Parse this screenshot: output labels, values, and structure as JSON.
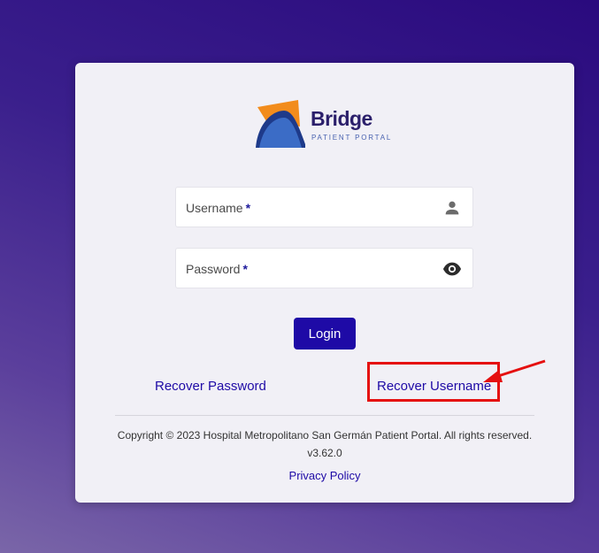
{
  "logo": {
    "title": "Bridge",
    "subtitle": "PATIENT PORTAL",
    "colors": {
      "orange": "#f28c1c",
      "navy": "#1e3a8a",
      "blue": "#3b6cc6"
    }
  },
  "form": {
    "username": {
      "label": "Username",
      "required_mark": "*",
      "value": "",
      "icon": "person-icon"
    },
    "password": {
      "label": "Password",
      "required_mark": "*",
      "value": "",
      "icon": "eye-icon"
    },
    "login_label": "Login"
  },
  "links": {
    "recover_password": "Recover Password",
    "recover_username": "Recover Username"
  },
  "footer": {
    "copyright": "Copyright © 2023 Hospital Metropolitano San Germán Patient Portal. All rights reserved.",
    "version": "v3.62.0",
    "privacy": "Privacy Policy"
  },
  "annotation": {
    "highlight_color": "#e51010"
  },
  "theme": {
    "accent": "#1e0aa6",
    "card_bg": "#f1f0f6"
  }
}
